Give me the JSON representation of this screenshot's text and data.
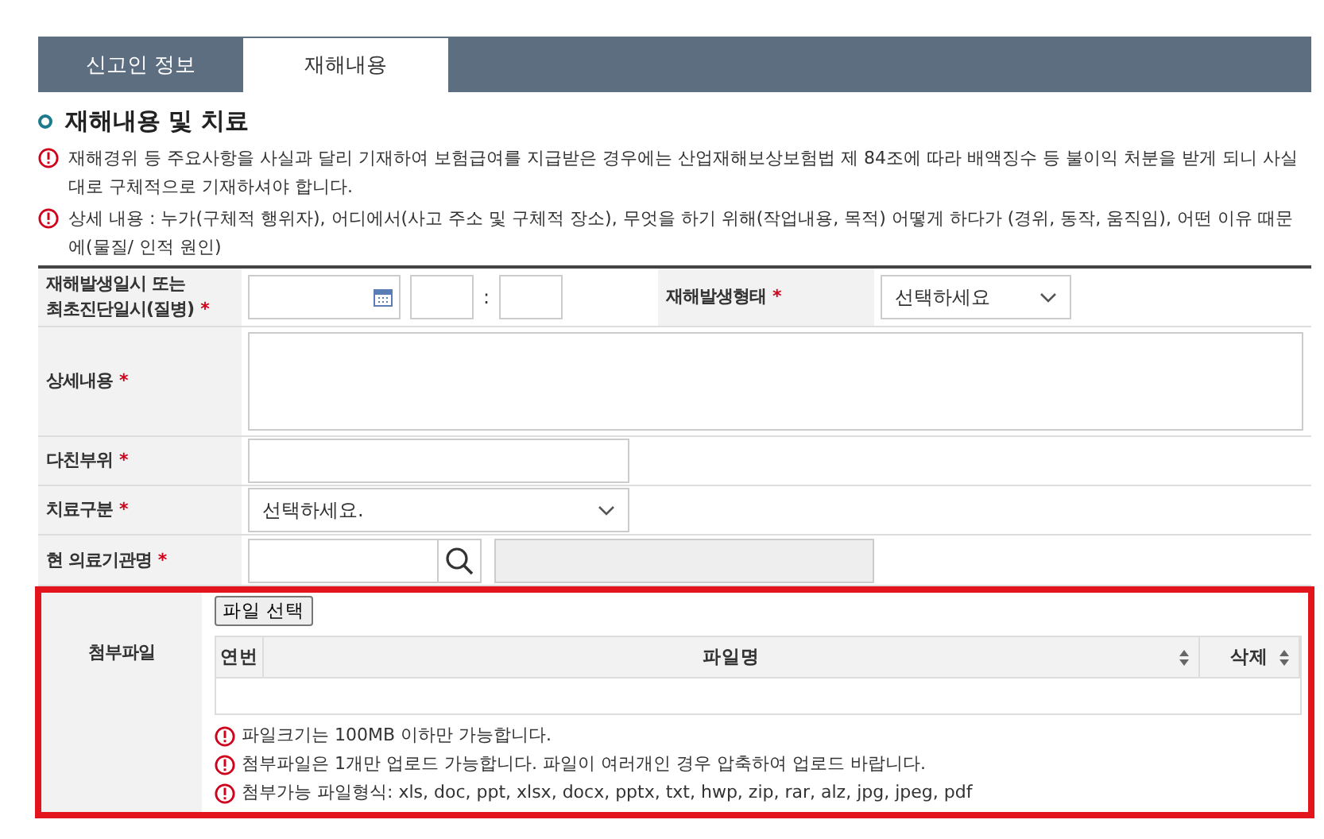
{
  "tabs": [
    {
      "label": "신고인 정보",
      "selected": false
    },
    {
      "label": "재해내용",
      "selected": true
    }
  ],
  "section_title": "재해내용 및 치료",
  "notices": [
    "재해경위 등 주요사항을 사실과 달리 기재하여 보험급여를 지급받은 경우에는 산업재해보상보험법 제 84조에 따라 배액징수 등 불이익 처분을 받게 되니 사실대로 구체적으로 기재하셔야 합니다.",
    "상세 내용 : 누가(구체적 행위자), 어디에서(사고 주소 및 구체적 장소), 무엇을 하기 위해(작업내용, 목적) 어떻게 하다가 (경위, 동작, 움직임), 어떤 이유 때문에(물질/ 인적 원인)"
  ],
  "form": {
    "occurred": {
      "label": "재해발생일시 또는 최초진단일시(질병)",
      "required_mark": "*",
      "time_separator": ":"
    },
    "type": {
      "label": "재해발생형태",
      "required_mark": "*",
      "value": "선택하세요"
    },
    "details": {
      "label": "상세내용",
      "required_mark": "*"
    },
    "injured_part": {
      "label": "다친부위",
      "required_mark": "*"
    },
    "treatment": {
      "label": "치료구분",
      "required_mark": "*",
      "value": "선택하세요."
    },
    "hospital": {
      "label": "현 의료기관명",
      "required_mark": "*"
    }
  },
  "attachment": {
    "label": "첨부파일",
    "highlighted": true,
    "button": "파일 선택",
    "columns": [
      {
        "label": "연번",
        "sortable": false
      },
      {
        "label": "파일명",
        "sortable": true
      },
      {
        "label": "삭제",
        "sortable": true
      }
    ],
    "notes": [
      "파일크기는 100MB 이하만 가능합니다.",
      "첨부파일은 1개만 업로드 가능합니다. 파일이 여러개인 경우 압축하여 업로드 바랍니다.",
      "첨부가능 파일형식: xls, doc, ppt, xlsx, docx, pptx, txt, hwp, zip, rar, alz, jpg, jpeg, pdf"
    ]
  }
}
